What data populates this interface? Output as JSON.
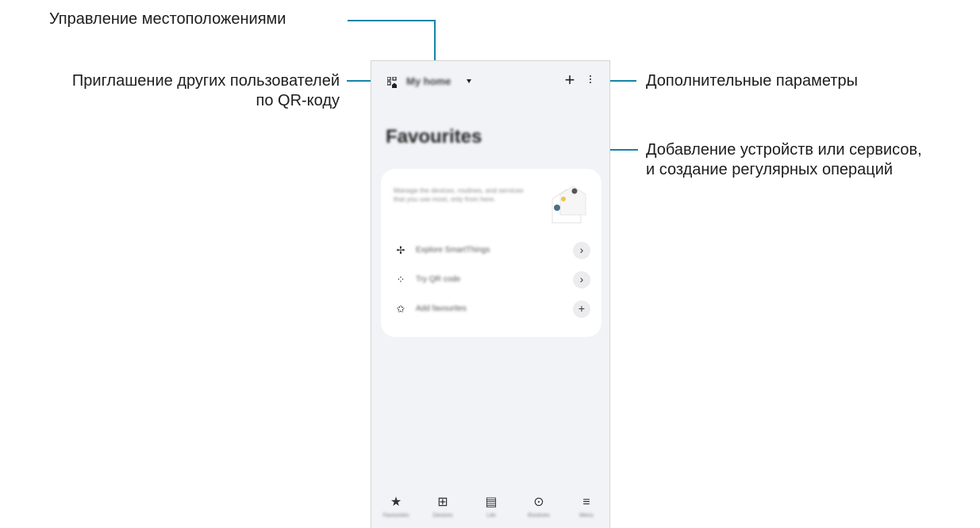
{
  "callouts": {
    "manage_locations": "Управление местоположениями",
    "invite_line1": "Приглашение других пользователей",
    "invite_line2": "по QR-коду",
    "more_options": "Дополнительные параметры",
    "add_line1": "Добавление устройств или сервисов,",
    "add_line2": "и создание регулярных операций"
  },
  "app": {
    "location": "My home",
    "add_icon": "+",
    "page_title": "Favourites",
    "card": {
      "intro": "Manage the devices, routines, and services that you use most, only from here.",
      "rows": [
        {
          "icon": "fan-icon",
          "glyph": "✢",
          "label": "Explore SmartThings",
          "action": "›"
        },
        {
          "icon": "qr-home-icon",
          "glyph": "⁘",
          "label": "Try QR code",
          "action": "›"
        },
        {
          "icon": "star-outline-icon",
          "glyph": "✩",
          "label": "Add favourites",
          "action": "+"
        }
      ]
    },
    "nav": [
      {
        "icon": "star-icon",
        "glyph": "★",
        "label": "Favourites"
      },
      {
        "icon": "devices-icon",
        "glyph": "⊞",
        "label": "Devices"
      },
      {
        "icon": "life-icon",
        "glyph": "▤",
        "label": "Life"
      },
      {
        "icon": "routines-icon",
        "glyph": "⊙",
        "label": "Routines"
      },
      {
        "icon": "menu-icon",
        "glyph": "≡",
        "label": "Menu"
      }
    ]
  },
  "colors": {
    "accent_line": "#1683a6",
    "phone_bg": "#f2f3f7"
  }
}
